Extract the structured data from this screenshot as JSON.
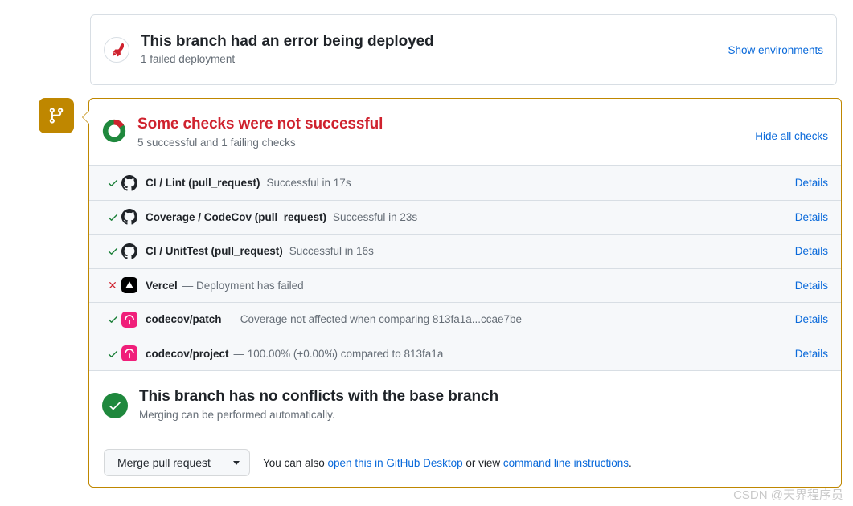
{
  "deployment": {
    "icon": "rocket-icon",
    "title": "This branch had an error being deployed",
    "subtitle": "1 failed deployment",
    "action_label": "Show environments",
    "accent_color": "#cf222e"
  },
  "timeline_badge": {
    "icon": "git-branch-icon",
    "color": "#bf8700"
  },
  "checks": {
    "icon": "donut-chart-icon",
    "title": "Some checks were not successful",
    "subtitle": "5 successful and 1 failing checks",
    "action_label": "Hide all checks",
    "title_color": "#cf222e",
    "donut": {
      "success_color": "#1f883d",
      "failure_color": "#cf222e",
      "failure_fraction": 0.167
    },
    "details_label": "Details",
    "rows": [
      {
        "status": "success",
        "status_icon": "check-icon",
        "app_icon": "github-actions-icon",
        "name": "CI / Lint (pull_request)",
        "description": "Successful in 17s",
        "details_label": "Details"
      },
      {
        "status": "success",
        "status_icon": "check-icon",
        "app_icon": "github-actions-icon",
        "name": "Coverage / CodeCov (pull_request)",
        "description": "Successful in 23s",
        "details_label": "Details"
      },
      {
        "status": "success",
        "status_icon": "check-icon",
        "app_icon": "github-actions-icon",
        "name": "CI / UnitTest (pull_request)",
        "description": "Successful in 16s",
        "details_label": "Details"
      },
      {
        "status": "failure",
        "status_icon": "x-icon",
        "app_icon": "vercel-icon",
        "name": "Vercel",
        "description": "— Deployment has failed",
        "details_label": "Details"
      },
      {
        "status": "success",
        "status_icon": "check-icon",
        "app_icon": "codecov-icon",
        "name": "codecov/patch",
        "description": "— Coverage not affected when comparing 813fa1a...ccae7be",
        "details_label": "Details"
      },
      {
        "status": "success",
        "status_icon": "check-icon",
        "app_icon": "codecov-icon",
        "name": "codecov/project",
        "description": "— 100.00% (+0.00%) compared to 813fa1a",
        "details_label": "Details"
      }
    ]
  },
  "conflicts": {
    "icon": "check-circle-icon",
    "title": "This branch has no conflicts with the base branch",
    "subtitle": "Merging can be performed automatically.",
    "color": "#1f883d"
  },
  "merge": {
    "button_label": "Merge pull request",
    "dropdown_icon": "chevron-down-icon",
    "note_prefix": "You can also ",
    "link_desktop": "open this in GitHub Desktop",
    "note_middle": " or view ",
    "link_cli": "command line instructions",
    "note_suffix": "."
  },
  "watermark": {
    "text": "CSDN @天界程序员"
  },
  "top_cut_text": ""
}
